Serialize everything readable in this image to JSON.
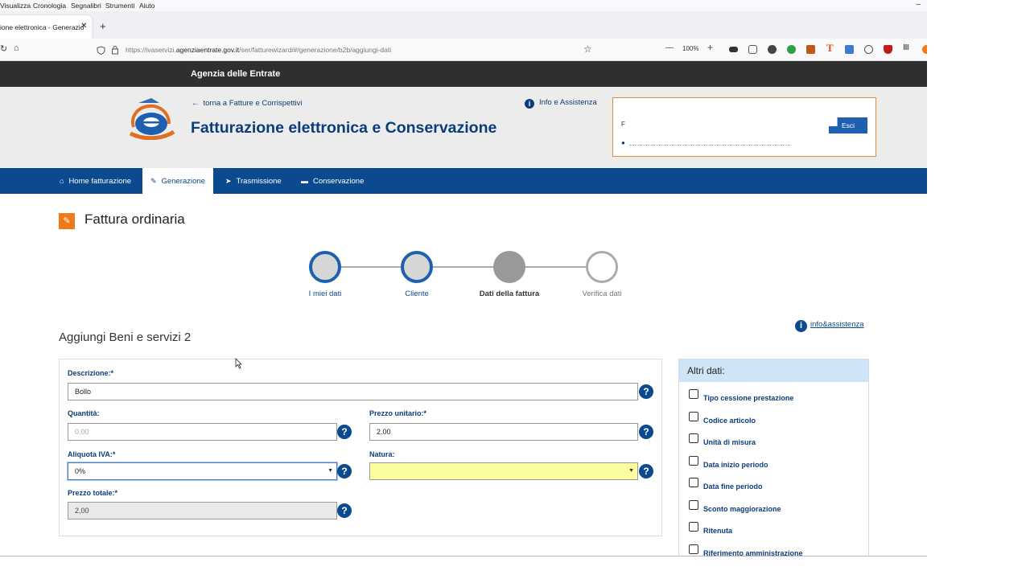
{
  "browser": {
    "menu": [
      "Visualizza",
      "Cronologia",
      "Segnalibri",
      "Strumenti",
      "Aiuto"
    ],
    "tab_title": "ione elettronica - Generazio",
    "url_prefix": "https://ivaservizi.",
    "url_domain": "agenziaentrate.gov.it",
    "url_path": "/ser/fatturewizard/#/generazione/b2b/aggiungi-dati",
    "zoom": "100%"
  },
  "site": {
    "brand": "Agenzia delle Entrate",
    "back_link": "torna a Fatture e Corrispettivi",
    "app_title": "Fatturazione elettronica e Conservazione",
    "info_link": "Info e Assistenza",
    "user_initial": "F",
    "logout": "Esci"
  },
  "nav": {
    "items": [
      {
        "label": "Home fatturazione",
        "icon": "home-icon"
      },
      {
        "label": "Generazione",
        "icon": "pencil-icon"
      },
      {
        "label": "Trasmissione",
        "icon": "send-icon"
      },
      {
        "label": "Conservazione",
        "icon": "archive-icon"
      }
    ],
    "active": "Generazione"
  },
  "page": {
    "title": "Fattura ordinaria",
    "section_title": "Aggiungi Beni e servizi 2",
    "help_link": "info&assistenza"
  },
  "stepper": {
    "steps": [
      {
        "label": "I miei dati",
        "state": "done"
      },
      {
        "label": "Cliente",
        "state": "done"
      },
      {
        "label": "Dati della fattura",
        "state": "current"
      },
      {
        "label": "Verifica dati",
        "state": "todo"
      }
    ]
  },
  "form": {
    "descrizione": {
      "label": "Descrizione:*",
      "value": "Bollo"
    },
    "quantita": {
      "label": "Quantità:",
      "placeholder": "0.00"
    },
    "prezzo_unitario": {
      "label": "Prezzo unitario:*",
      "value": "2.00"
    },
    "aliquota_iva": {
      "label": "Aliquota IVA:*",
      "value": "0%"
    },
    "natura": {
      "label": "Natura:",
      "value": ""
    },
    "prezzo_totale": {
      "label": "Prezzo totale:*",
      "value": "2,00"
    },
    "help_glyph": "?"
  },
  "altri_dati": {
    "title": "Altri dati:",
    "options": [
      "Tipo cessione prestazione",
      "Codice articolo",
      "Unità di misura",
      "Data inizio periodo",
      "Data fine periodo",
      "Sconto maggiorazione",
      "Ritenuta",
      "Riferimento amministrazione"
    ]
  },
  "colors": {
    "nav_blue": "#0b4a8f",
    "accent_orange": "#f07a1a",
    "natura_highlight": "#fbfba0"
  }
}
